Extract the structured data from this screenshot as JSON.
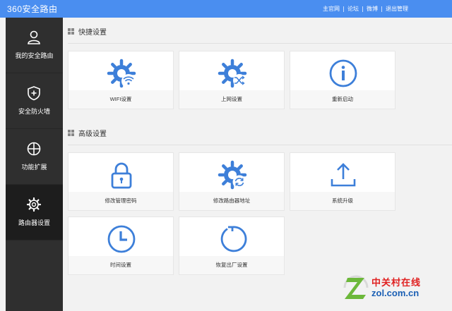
{
  "header": {
    "brand": "360安全路由",
    "links": [
      "主官网",
      "论坛",
      "微博",
      "退出管理"
    ]
  },
  "sidebar": {
    "items": [
      {
        "label": "我的安全路由",
        "icon": "user-icon"
      },
      {
        "label": "安全防火墙",
        "icon": "shield-plus-icon"
      },
      {
        "label": "功能扩展",
        "icon": "grid-circle-icon"
      },
      {
        "label": "路由器设置",
        "icon": "gear-icon",
        "active": true
      }
    ]
  },
  "sections": [
    {
      "title": "快捷设置",
      "cards": [
        {
          "label": "WIFI设置",
          "icon": "gear-wifi-icon"
        },
        {
          "label": "上网设置",
          "icon": "gear-shuffle-icon"
        },
        {
          "label": "重新启动",
          "icon": "info-circle-icon"
        }
      ]
    },
    {
      "title": "高级设置",
      "cards": [
        {
          "label": "修改管理密码",
          "icon": "lock-icon"
        },
        {
          "label": "修改路由器地址",
          "icon": "gear-refresh-icon"
        },
        {
          "label": "系统升级",
          "icon": "upload-icon"
        },
        {
          "label": "时间设置",
          "icon": "clock-icon"
        },
        {
          "label": "恢复出厂设置",
          "icon": "restore-icon"
        }
      ]
    }
  ],
  "watermark": {
    "cn": "中关村在线",
    "en": "zol.com.cn"
  },
  "colors": {
    "accent": "#4a8ef0",
    "icon": "#3d7fd9",
    "sidebar": "#2f2f2f",
    "sidebar_active": "#1d1d1d"
  }
}
